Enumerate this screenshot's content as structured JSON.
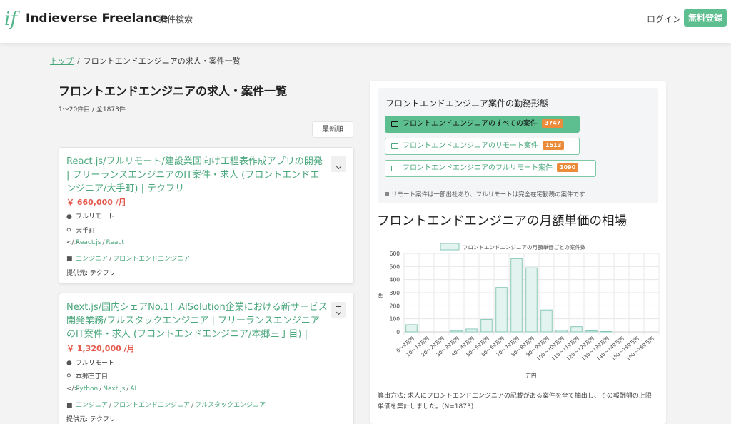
{
  "header": {
    "logo_mark": "if",
    "brand": "Indieverse Freelance",
    "nav_search": "案件検索",
    "login": "ログイン",
    "signup": "無料登録"
  },
  "breadcrumb": {
    "home": "トップ",
    "separator": "/",
    "current": "フロントエンドエンジニアの求人・案件一覧"
  },
  "page": {
    "title": "フロントエンドエンジニアの求人・案件一覧",
    "result_count": "1〜20件目 / 全1873件",
    "sort_label": "最新順"
  },
  "jobs": [
    {
      "title": "React.js/フルリモート/建設業回向け工程表作成アプリの開発 | フリーランスエンジニアのIT案件・求人 (フロントエンドエンジニア/大手町) | テクフリ",
      "salary": "￥ 660,000 /月",
      "work_style": "フルリモート",
      "location": "大手町",
      "skills": [
        "React.js",
        "React"
      ],
      "categories": [
        "エンジニア",
        "フロントエンドエンジニア"
      ],
      "provider": "提供元: テクフリ"
    },
    {
      "title": "Next.js/国内シェアNo.1！AISolution企業における新サービス開発業務/フルスタックエンジニア | フリーランスエンジニアのIT案件・求人 (フロントエンドエンジニア/本郷三丁目) |",
      "salary": "￥ 1,320,000 /月",
      "work_style": "フルリモート",
      "location": "本郷三丁目",
      "skills": [
        "Python",
        "Next.js",
        "AI"
      ],
      "categories": [
        "エンジニア",
        "フロントエンドエンジニア",
        "フルスタックエンジニア"
      ],
      "provider": "提供元: テクフリ"
    }
  ],
  "work_styles": {
    "title": "フロントエンドエンジニア案件の勤務形態",
    "options": [
      {
        "label": "フロントエンドエンジニアのすべての案件",
        "count": "3747",
        "active": true
      },
      {
        "label": "フロントエンドエンジニアのリモート案件",
        "count": "1513",
        "active": false
      },
      {
        "label": "フロントエンドエンジニアのフルリモート案件",
        "count": "1090",
        "active": false
      }
    ],
    "note": "リモート案件は一部出社あり、フルリモートは完全在宅勤務の案件です"
  },
  "salary_section": {
    "heading": "フロントエンドエンジニアの月額単価の相場",
    "calc_note": "算出方法: 求人にフロントエンドエンジニアの記載がある案件を全て抽出し、その報酬額の上限単価を集計しました。(N=1873)"
  },
  "chart_data": {
    "type": "bar",
    "title": "",
    "categories": [
      "0〜9万円",
      "10〜19万円",
      "20〜29万円",
      "30〜39万円",
      "40〜49万円",
      "50〜59万円",
      "60〜69万円",
      "70〜79万円",
      "80〜89万円",
      "90〜99万円",
      "100〜109万円",
      "110〜119万円",
      "120〜129万円",
      "130〜139万円",
      "140〜149万円",
      "150〜159万円",
      "160〜169万円"
    ],
    "series": [
      {
        "name": "フロントエンドエンジニアの月額単価ごとの案件数",
        "values": [
          55,
          0,
          0,
          10,
          22,
          95,
          340,
          560,
          490,
          168,
          12,
          40,
          8,
          3,
          0,
          0,
          0
        ]
      }
    ],
    "xlabel": "万円",
    "ylabel": "件",
    "ylim": [
      0,
      600
    ],
    "yticks": [
      0,
      100,
      200,
      300,
      400,
      500,
      600
    ],
    "grid": true,
    "legend": "top",
    "bar_fill": "#e3f4f0",
    "bar_stroke": "#86c8b8"
  }
}
